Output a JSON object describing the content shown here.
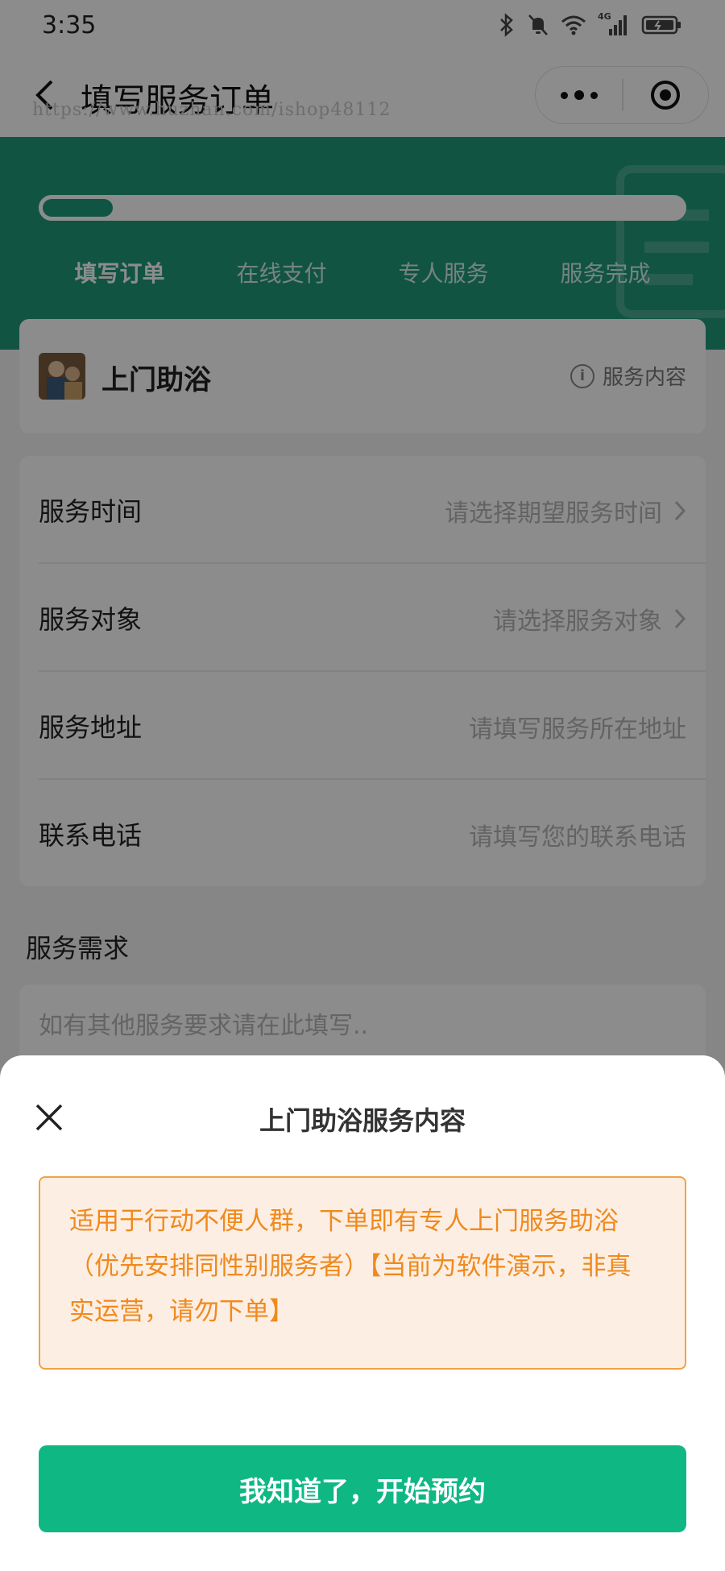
{
  "status_bar": {
    "time": "3:35",
    "network_label": "4G"
  },
  "nav": {
    "title": "填写服务订单",
    "watermark": "https://www.huzhan.com/ishop48112"
  },
  "progress": {
    "fraction": 0.11,
    "steps": [
      "填写订单",
      "在线支付",
      "专人服务",
      "服务完成"
    ],
    "active_step": 0
  },
  "service": {
    "name": "上门助浴",
    "info_label": "服务内容"
  },
  "form": {
    "rows": [
      {
        "label": "服务时间",
        "value": "请选择期望服务时间",
        "has_arrow": true
      },
      {
        "label": "服务对象",
        "value": "请选择服务对象",
        "has_arrow": true
      },
      {
        "label": "服务地址",
        "value": "请填写服务所在地址",
        "has_arrow": false
      },
      {
        "label": "联系电话",
        "value": "请填写您的联系电话",
        "has_arrow": false
      }
    ]
  },
  "need": {
    "title": "服务需求",
    "placeholder": "如有其他服务要求请在此填写.."
  },
  "sheet": {
    "title": "上门助浴服务内容",
    "notice": "适用于行动不便人群，下单即有专人上门服务助浴（优先安排同性别服务者）【当前为软件演示，非真实运营，请勿下单】",
    "confirm_label": "我知道了，开始预约"
  },
  "colors": {
    "brand_green": "#1f9a79",
    "button_green": "#0fb783",
    "notice_orange": "#ef8a1e",
    "notice_bg": "#fdeee3"
  }
}
